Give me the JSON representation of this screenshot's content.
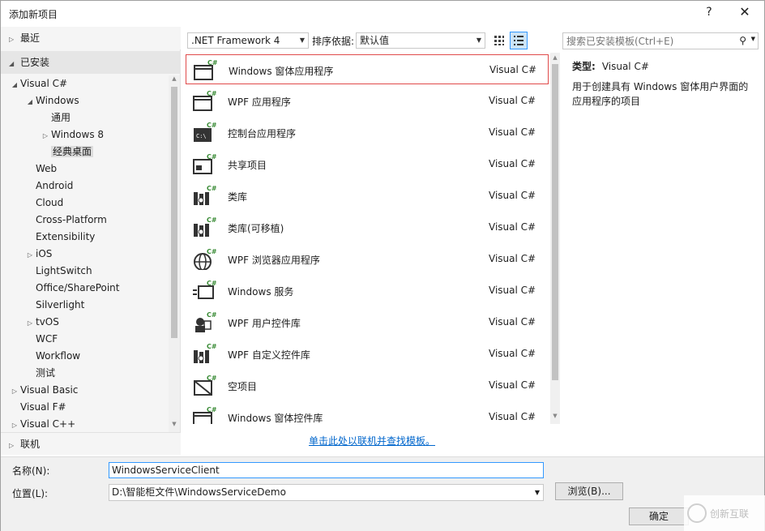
{
  "window": {
    "title": "添加新项目",
    "help": "?",
    "close": "✕"
  },
  "left": {
    "recent": "最近",
    "installed": "已安装",
    "online": "联机",
    "tree": [
      {
        "label": "Visual C#",
        "indent": 0,
        "arrow": "open"
      },
      {
        "label": "Windows",
        "indent": 1,
        "arrow": "open"
      },
      {
        "label": "通用",
        "indent": 2,
        "arrow": "none"
      },
      {
        "label": "Windows 8",
        "indent": 2,
        "arrow": "closed"
      },
      {
        "label": "经典桌面",
        "indent": 2,
        "arrow": "none",
        "selected": true
      },
      {
        "label": "Web",
        "indent": 1,
        "arrow": "none"
      },
      {
        "label": "Android",
        "indent": 1,
        "arrow": "none"
      },
      {
        "label": "Cloud",
        "indent": 1,
        "arrow": "none"
      },
      {
        "label": "Cross-Platform",
        "indent": 1,
        "arrow": "none"
      },
      {
        "label": "Extensibility",
        "indent": 1,
        "arrow": "none"
      },
      {
        "label": "iOS",
        "indent": 1,
        "arrow": "closed"
      },
      {
        "label": "LightSwitch",
        "indent": 1,
        "arrow": "none"
      },
      {
        "label": "Office/SharePoint",
        "indent": 1,
        "arrow": "none"
      },
      {
        "label": "Silverlight",
        "indent": 1,
        "arrow": "none"
      },
      {
        "label": "tvOS",
        "indent": 1,
        "arrow": "closed"
      },
      {
        "label": "WCF",
        "indent": 1,
        "arrow": "none"
      },
      {
        "label": "Workflow",
        "indent": 1,
        "arrow": "none"
      },
      {
        "label": "测试",
        "indent": 1,
        "arrow": "none"
      },
      {
        "label": "Visual Basic",
        "indent": 0,
        "arrow": "closed"
      },
      {
        "label": "Visual F#",
        "indent": 0,
        "arrow": "none"
      },
      {
        "label": "Visual C++",
        "indent": 0,
        "arrow": "closed"
      }
    ]
  },
  "toolbar": {
    "framework": ".NET Framework 4",
    "sort_label": "排序依据:",
    "sort_value": "默认值"
  },
  "templates": [
    {
      "name": "Windows 窗体应用程序",
      "lang": "Visual C#",
      "icon": "windows-forms-app-icon",
      "selected": true
    },
    {
      "name": "WPF 应用程序",
      "lang": "Visual C#",
      "icon": "wpf-app-icon"
    },
    {
      "name": "控制台应用程序",
      "lang": "Visual C#",
      "icon": "console-app-icon"
    },
    {
      "name": "共享项目",
      "lang": "Visual C#",
      "icon": "shared-project-icon"
    },
    {
      "name": "类库",
      "lang": "Visual C#",
      "icon": "class-library-icon"
    },
    {
      "name": "类库(可移植)",
      "lang": "Visual C#",
      "icon": "portable-library-icon"
    },
    {
      "name": "WPF 浏览器应用程序",
      "lang": "Visual C#",
      "icon": "wpf-browser-app-icon"
    },
    {
      "name": "Windows 服务",
      "lang": "Visual C#",
      "icon": "windows-service-icon"
    },
    {
      "name": "WPF 用户控件库",
      "lang": "Visual C#",
      "icon": "wpf-user-control-library-icon"
    },
    {
      "name": "WPF 自定义控件库",
      "lang": "Visual C#",
      "icon": "wpf-custom-control-library-icon"
    },
    {
      "name": "空项目",
      "lang": "Visual C#",
      "icon": "empty-project-icon"
    },
    {
      "name": "Windows 窗体控件库",
      "lang": "Visual C#",
      "icon": "windows-forms-control-library-icon"
    }
  ],
  "online_link": "单击此处以联机并查找模板。",
  "search": {
    "placeholder": "搜索已安装模板(Ctrl+E)"
  },
  "description": {
    "type_key": "类型:",
    "type_value": "Visual C#",
    "text": "用于创建具有 Windows 窗体用户界面的应用程序的项目"
  },
  "form": {
    "name_label": "名称(N):",
    "name_value": "WindowsServiceClient",
    "location_label": "位置(L):",
    "location_value": "D:\\智能柜文件\\WindowsServiceDemo",
    "browse_label": "浏览(B)...",
    "ok_label": "确定"
  },
  "watermark": {
    "text": "创新互联"
  },
  "colors": {
    "accent": "#3399ff",
    "selection_border": "#e04a4a",
    "link": "#0066cc"
  }
}
